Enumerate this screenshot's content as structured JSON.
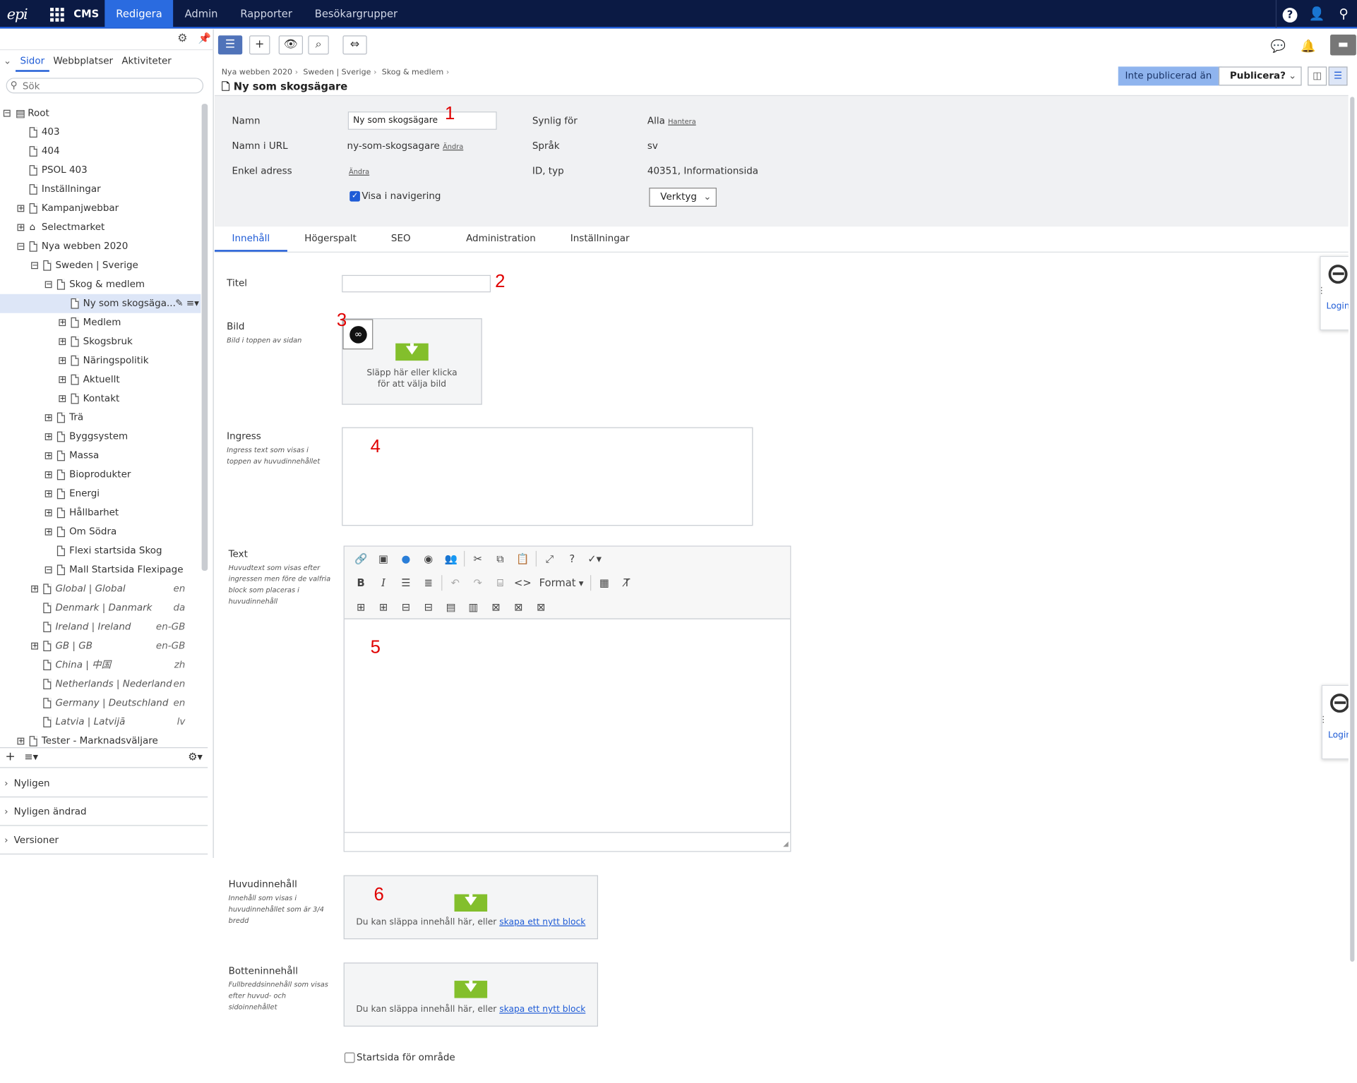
{
  "topbar": {
    "logo": "epi",
    "product": "CMS",
    "nav": [
      "Redigera",
      "Admin",
      "Rapporter",
      "Besökargrupper"
    ],
    "active_nav": "Redigera"
  },
  "left": {
    "tabs": [
      "Sidor",
      "Webbplatser",
      "Aktiviteter"
    ],
    "search_placeholder": "Sök",
    "tree": [
      {
        "label": "Root",
        "depth": 0,
        "exp": "minus",
        "icon": "root",
        "italic": false,
        "lang": "",
        "selected": false
      },
      {
        "label": "403",
        "depth": 1,
        "exp": "",
        "icon": "doc",
        "italic": false,
        "lang": "",
        "selected": false
      },
      {
        "label": "404",
        "depth": 1,
        "exp": "",
        "icon": "doc",
        "italic": false,
        "lang": "",
        "selected": false
      },
      {
        "label": "PSOL 403",
        "depth": 1,
        "exp": "",
        "icon": "doc",
        "italic": false,
        "lang": "",
        "selected": false
      },
      {
        "label": "Inställningar",
        "depth": 1,
        "exp": "",
        "icon": "doc",
        "italic": false,
        "lang": "",
        "selected": false
      },
      {
        "label": "Kampanjwebbar",
        "depth": 1,
        "exp": "plus",
        "icon": "doc",
        "italic": false,
        "lang": "",
        "selected": false
      },
      {
        "label": "Selectmarket",
        "depth": 1,
        "exp": "plus",
        "icon": "home",
        "italic": false,
        "lang": "",
        "selected": false
      },
      {
        "label": "Nya webben 2020",
        "depth": 1,
        "exp": "minus",
        "icon": "doc",
        "italic": false,
        "lang": "",
        "selected": false
      },
      {
        "label": "Sweden | Sverige",
        "depth": 2,
        "exp": "minus",
        "icon": "doc",
        "italic": false,
        "lang": "",
        "selected": false
      },
      {
        "label": "Skog & medlem",
        "depth": 3,
        "exp": "minus",
        "icon": "doc",
        "italic": false,
        "lang": "",
        "selected": false
      },
      {
        "label": "Ny som skogsäga...",
        "depth": 4,
        "exp": "",
        "icon": "doc",
        "italic": false,
        "lang": "",
        "selected": true
      },
      {
        "label": "Medlem",
        "depth": 4,
        "exp": "plus",
        "icon": "doc",
        "italic": false,
        "lang": "",
        "selected": false
      },
      {
        "label": "Skogsbruk",
        "depth": 4,
        "exp": "plus",
        "icon": "doc",
        "italic": false,
        "lang": "",
        "selected": false
      },
      {
        "label": "Näringspolitik",
        "depth": 4,
        "exp": "plus",
        "icon": "doc",
        "italic": false,
        "lang": "",
        "selected": false
      },
      {
        "label": "Aktuellt",
        "depth": 4,
        "exp": "plus",
        "icon": "doc",
        "italic": false,
        "lang": "",
        "selected": false
      },
      {
        "label": "Kontakt",
        "depth": 4,
        "exp": "plus",
        "icon": "doc",
        "italic": false,
        "lang": "",
        "selected": false
      },
      {
        "label": "Trä",
        "depth": 3,
        "exp": "plus",
        "icon": "doc",
        "italic": false,
        "lang": "",
        "selected": false
      },
      {
        "label": "Byggsystem",
        "depth": 3,
        "exp": "plus",
        "icon": "doc",
        "italic": false,
        "lang": "",
        "selected": false
      },
      {
        "label": "Massa",
        "depth": 3,
        "exp": "plus",
        "icon": "doc",
        "italic": false,
        "lang": "",
        "selected": false
      },
      {
        "label": "Bioprodukter",
        "depth": 3,
        "exp": "plus",
        "icon": "doc",
        "italic": false,
        "lang": "",
        "selected": false
      },
      {
        "label": "Energi",
        "depth": 3,
        "exp": "plus",
        "icon": "doc",
        "italic": false,
        "lang": "",
        "selected": false
      },
      {
        "label": "Hållbarhet",
        "depth": 3,
        "exp": "plus",
        "icon": "doc",
        "italic": false,
        "lang": "",
        "selected": false
      },
      {
        "label": "Om Södra",
        "depth": 3,
        "exp": "plus",
        "icon": "doc",
        "italic": false,
        "lang": "",
        "selected": false
      },
      {
        "label": "Flexi startsida Skog",
        "depth": 3,
        "exp": "",
        "icon": "doc",
        "italic": false,
        "lang": "",
        "selected": false
      },
      {
        "label": "Mall Startsida Flexipage",
        "depth": 3,
        "exp": "minus",
        "icon": "doc",
        "italic": false,
        "lang": "",
        "selected": false
      },
      {
        "label": "Global | Global",
        "depth": 2,
        "exp": "plus",
        "icon": "doc",
        "italic": true,
        "lang": "en",
        "selected": false
      },
      {
        "label": "Denmark | Danmark",
        "depth": 2,
        "exp": "",
        "icon": "doc",
        "italic": true,
        "lang": "da",
        "selected": false
      },
      {
        "label": "Ireland | Ireland",
        "depth": 2,
        "exp": "",
        "icon": "doc",
        "italic": true,
        "lang": "en-GB",
        "selected": false
      },
      {
        "label": "GB | GB",
        "depth": 2,
        "exp": "plus",
        "icon": "doc",
        "italic": true,
        "lang": "en-GB",
        "selected": false
      },
      {
        "label": "China | 中国",
        "depth": 2,
        "exp": "",
        "icon": "doc",
        "italic": true,
        "lang": "zh",
        "selected": false
      },
      {
        "label": "Netherlands | Nederland",
        "depth": 2,
        "exp": "",
        "icon": "doc",
        "italic": true,
        "lang": "en",
        "selected": false
      },
      {
        "label": "Germany | Deutschland",
        "depth": 2,
        "exp": "",
        "icon": "doc",
        "italic": true,
        "lang": "en",
        "selected": false
      },
      {
        "label": "Latvia | Latvijā",
        "depth": 2,
        "exp": "",
        "icon": "doc",
        "italic": true,
        "lang": "lv",
        "selected": false
      },
      {
        "label": "Tester - Marknadsväljare",
        "depth": 1,
        "exp": "plus",
        "icon": "doc",
        "italic": false,
        "lang": "",
        "selected": false
      }
    ],
    "accordion": [
      "Nyligen",
      "Nyligen ändrad",
      "Versioner"
    ]
  },
  "header": {
    "breadcrumbs": [
      "Nya webben 2020",
      "Sweden | Sverige",
      "Skog & medlem"
    ],
    "title": "Ny som skogsägare",
    "status": "Inte publicerad än",
    "publish_label": "Publicera?"
  },
  "props": {
    "name_label": "Namn",
    "name_value": "Ny som skogsägare",
    "url_label": "Namn i URL",
    "url_value": "ny-som-skogsagare",
    "change_link": "Ändra",
    "simple_label": "Enkel adress",
    "nav_checkbox_label": "Visa i navigering",
    "visible_label": "Synlig för",
    "visible_value": "Alla",
    "manage_link": "Hantera",
    "lang_label": "Språk",
    "lang_value": "sv",
    "id_label": "ID, typ",
    "id_value": "40351, Informationsida",
    "tools_label": "Verktyg"
  },
  "tabs": [
    "Innehåll",
    "Högerspalt",
    "SEO",
    "Administration",
    "Inställningar"
  ],
  "fields": {
    "titel_label": "Titel",
    "bild_label": "Bild",
    "bild_desc": "Bild i toppen av sidan",
    "bild_drop": "Släpp här eller klicka för att välja bild",
    "ingress_label": "Ingress",
    "ingress_desc": "Ingress text som visas i toppen av huvudinnehållet",
    "text_label": "Text",
    "text_desc": "Huvudtext som visas efter ingressen men före de valfria block som placeras i huvudinnehåll",
    "format_label": "Format",
    "huvud_label": "Huvudinnehåll",
    "huvud_desc": "Innehåll som visas i huvudinnehållet som är 3/4 bredd",
    "botten_label": "Botteninnehåll",
    "botten_desc": "Fullbreddsinnehåll som visas efter huvud- och sidoinnehållet",
    "drop_text": "Du kan släppa innehåll här, eller",
    "drop_link": "skapa ett nytt block",
    "startpage_label": "Startsida för område"
  },
  "annotations": [
    "1",
    "2",
    "3",
    "4",
    "5",
    "6"
  ],
  "widgets": {
    "login": "Login"
  }
}
